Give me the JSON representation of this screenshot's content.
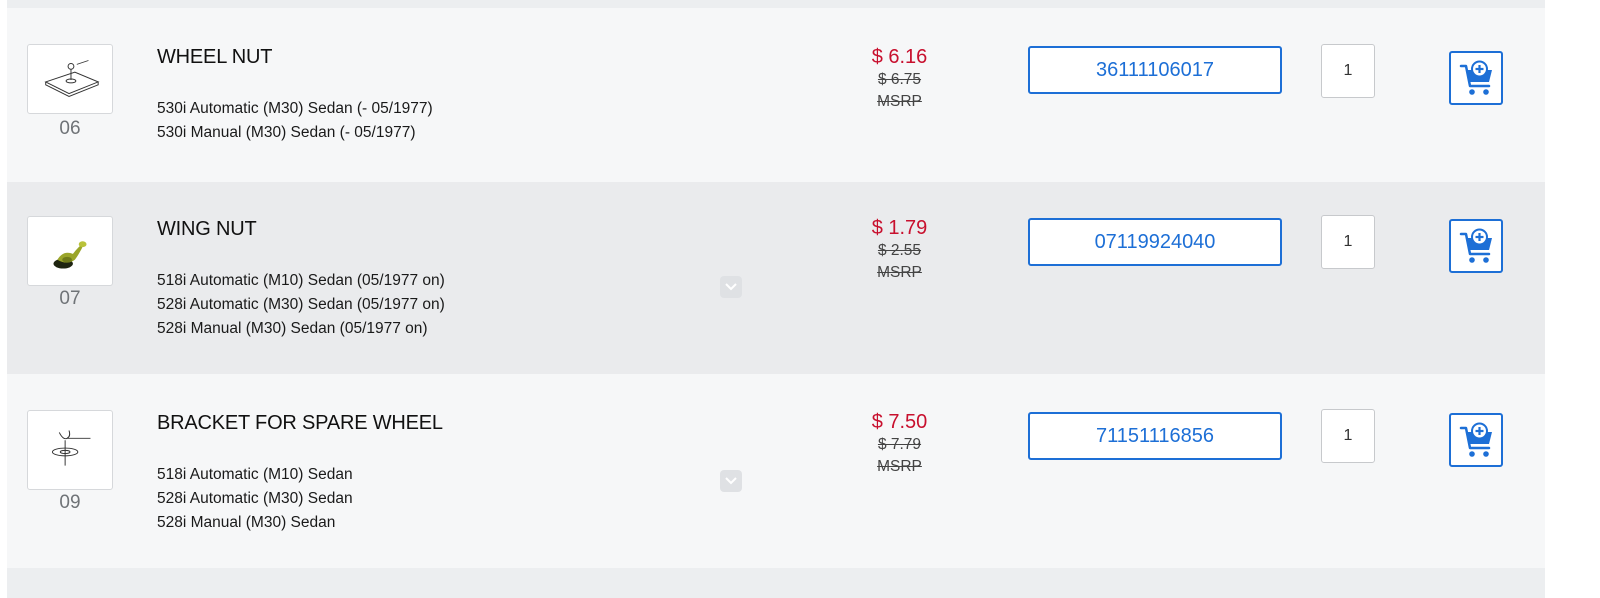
{
  "parts": [
    {
      "ref": "06",
      "title": "WHEEL NUT",
      "fitments": [
        "530i Automatic (M30) Sedan (- 05/1977)",
        "530i Manual (M30) Sedan (- 05/1977)"
      ],
      "price": "$ 6.16",
      "msrp": "$ 6.75",
      "msrp_label": "MSRP",
      "part_number": "36111106017",
      "qty": "1",
      "thumbnail_icon": "wheel-nut-diagram-icon"
    },
    {
      "ref": "07",
      "title": "WING NUT",
      "fitments": [
        "518i Automatic (M10) Sedan (05/1977 on)",
        "528i Automatic (M30) Sedan (05/1977 on)",
        "528i Manual (M30) Sedan (05/1977 on)"
      ],
      "price": "$ 1.79",
      "msrp": "$ 2.55",
      "msrp_label": "MSRP",
      "part_number": "07119924040",
      "qty": "1",
      "thumbnail_icon": "wing-nut-photo-icon"
    },
    {
      "ref": "09",
      "title": "BRACKET FOR SPARE WHEEL",
      "fitments": [
        "518i Automatic (M10) Sedan",
        "528i Automatic (M30) Sedan",
        "528i Manual (M30) Sedan"
      ],
      "price": "$ 7.50",
      "msrp": "$ 7.79",
      "msrp_label": "MSRP",
      "part_number": "71151116856",
      "qty": "1",
      "thumbnail_icon": "bracket-diagram-icon"
    }
  ],
  "colors": {
    "price": "#c8102e",
    "accent": "#1d6fd6",
    "row_light": "#f6f7f8",
    "row_dark": "#eaebed"
  }
}
